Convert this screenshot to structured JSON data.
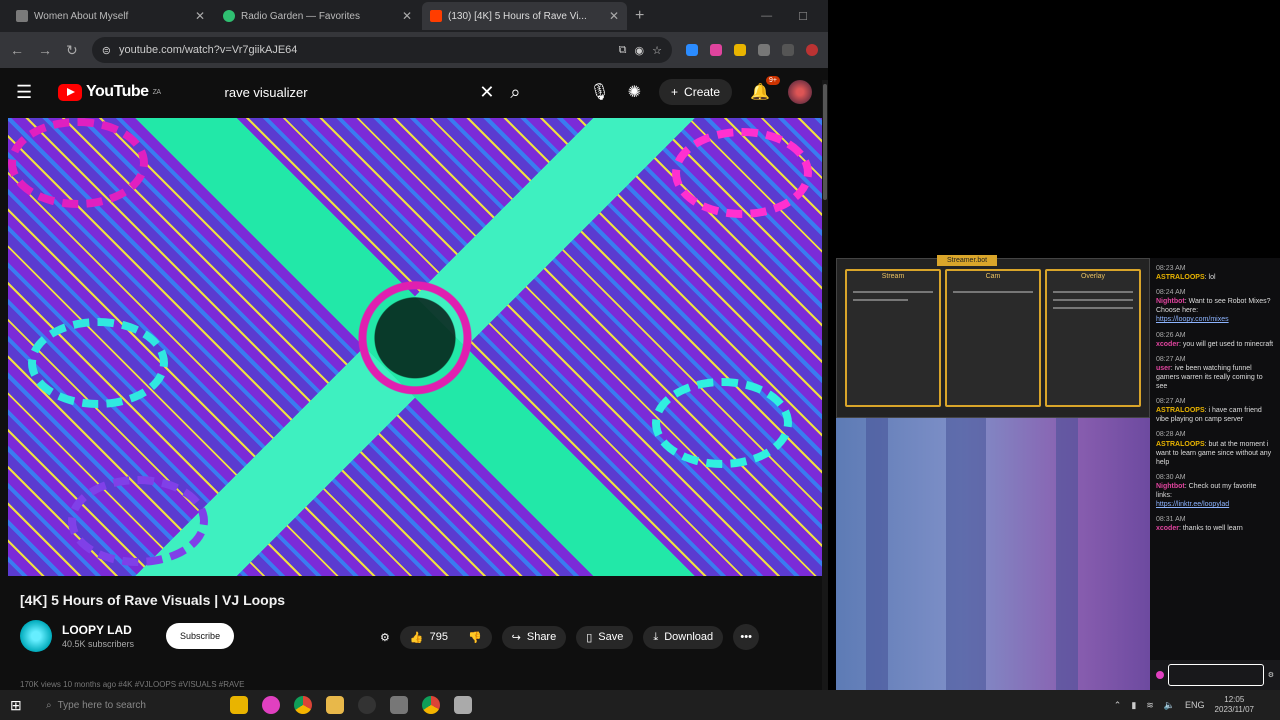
{
  "tabs": [
    {
      "title": "Women About Myself",
      "color": "#7a7a7a"
    },
    {
      "title": "Radio Garden — Favorites",
      "color": "#2fbf71"
    },
    {
      "title": "(130) [4K] 5 Hours of Rave Vi...",
      "color": "#ff3d00"
    }
  ],
  "address": {
    "url": "youtube.com/watch?v=Vr7giikAJE64"
  },
  "youtube": {
    "logo_text": "YouTube",
    "region": "ZA",
    "search_value": "rave visualizer",
    "create_label": "Create",
    "notif_count": "9+"
  },
  "video": {
    "title": "[4K] 5 Hours of Rave Visuals | VJ Loops",
    "channel": "LOOPY LAD",
    "subscribers": "40.5K subscribers",
    "subscribe_label": "Subscribe",
    "likes": "795",
    "share_label": "Share",
    "save_label": "Save",
    "download_label": "Download",
    "desc_preview": "170K views  10 months ago  #4K #VJLOOPS #VISUALS #RAVE"
  },
  "stream": {
    "obs_tab": "Streamer.bot",
    "panels": [
      "Stream",
      "Cam",
      "Overlay"
    ]
  },
  "chat": {
    "messages": [
      {
        "time": "08:23 AM",
        "user": "ASTRALOOPS",
        "text": "lol",
        "color": "#e9b400"
      },
      {
        "time": "08:24 AM",
        "user": "Nightbot",
        "text": "Want to see Robot Mixes? Choose here:",
        "link": "https://loopy.com/mixes",
        "color": "#e0449e"
      },
      {
        "time": "08:26 AM",
        "user": "xcoder",
        "text": "you will get used to minecraft",
        "color": "#e0449e"
      },
      {
        "time": "08:27 AM",
        "user": "user",
        "text": "ive been watching funnel gamers warren its really coming to see",
        "color": "#e0449e"
      },
      {
        "time": "08:27 AM",
        "user": "ASTRALOOPS",
        "text": "i have cam friend vibe playing on camp server",
        "color": "#e9b400"
      },
      {
        "time": "08:28 AM",
        "user": "ASTRALOOPS",
        "text": "but at the moment i want to learn game since without any help",
        "color": "#e9b400"
      },
      {
        "time": "08:30 AM",
        "user": "Nightbot",
        "text": "Check out my favorite links:",
        "link": "https://linktr.ee/loopylad",
        "color": "#e0449e"
      },
      {
        "time": "08:31 AM",
        "user": "xcoder",
        "text": "thanks to well learn",
        "color": "#e0449e"
      }
    ]
  },
  "taskbar": {
    "search_placeholder": "Type here to search",
    "lang": "ENG",
    "time": "12:05",
    "date": "2023/11/07"
  }
}
